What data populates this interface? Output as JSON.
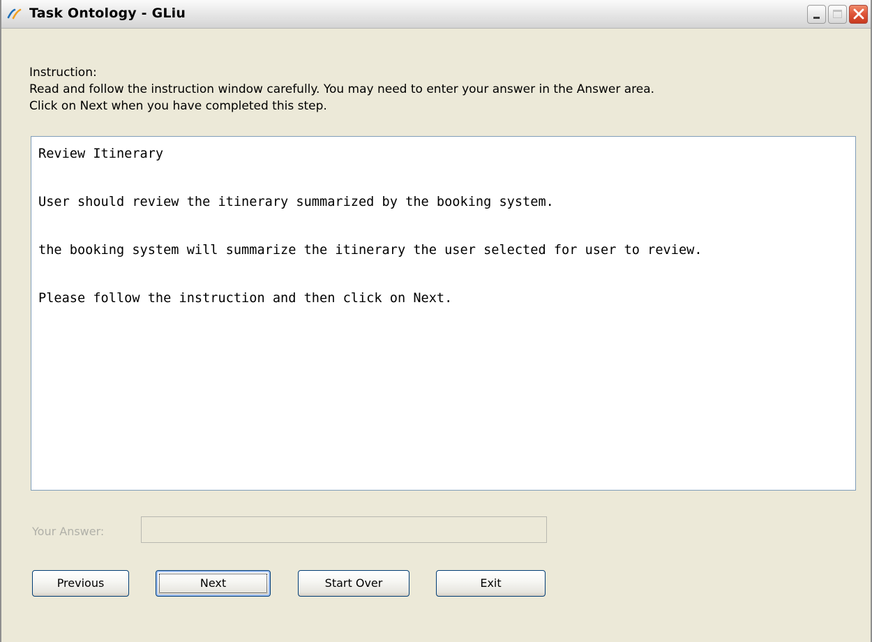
{
  "window": {
    "title": "Task Ontology - GLiu"
  },
  "instruction": {
    "heading": "Instruction:",
    "line1": "Read and follow the instruction window carefully. You may need to enter your answer in the Answer area.",
    "line2": "Click on Next when you have completed this step."
  },
  "content": {
    "title": "Review Itinerary",
    "paragraph1": "User should review the itinerary summarized by the booking system.",
    "paragraph2": "the booking system will summarize the itinerary the user selected for user to review.",
    "paragraph3": "Please follow the instruction and then click on Next."
  },
  "answer": {
    "label": "Your Answer:",
    "value": ""
  },
  "buttons": {
    "previous": "Previous",
    "next": "Next",
    "start_over": "Start Over",
    "exit": "Exit"
  },
  "icons": {
    "app": "app-logo-icon",
    "minimize": "minimize-icon",
    "maximize": "maximize-icon",
    "close": "close-icon"
  },
  "colors": {
    "close_button": "#e0573a",
    "textarea_border": "#7f9db9",
    "disabled_text": "#b0b0a8"
  }
}
